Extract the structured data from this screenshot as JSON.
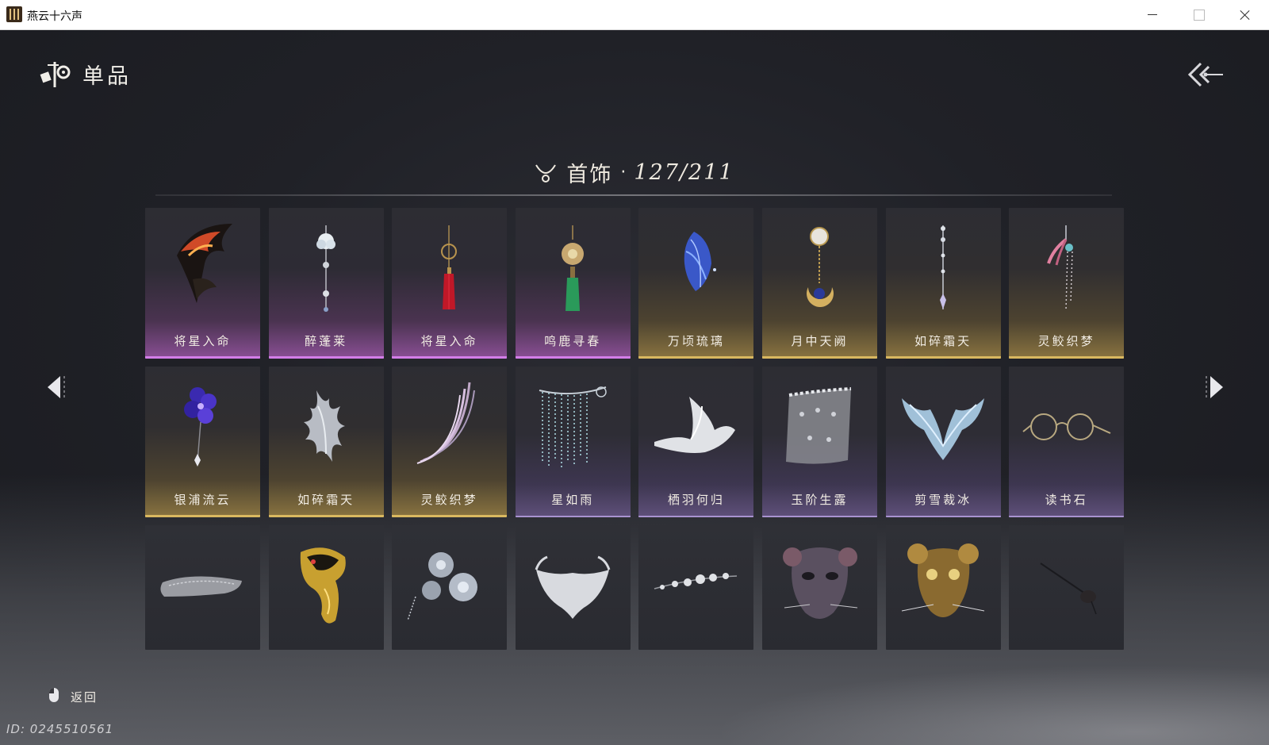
{
  "window": {
    "title": "燕云十六声"
  },
  "header": {
    "title": "单品"
  },
  "category": {
    "label": "首饰",
    "separator": "·",
    "count": "127/211"
  },
  "items": [
    {
      "name": "将星入命",
      "rarity": "purple",
      "icon": "flame-wing-ornament-icon"
    },
    {
      "name": "醉蓬莱",
      "rarity": "purple",
      "icon": "flower-pendant-icon"
    },
    {
      "name": "将星入命",
      "rarity": "purple",
      "icon": "red-tassel-pendant-icon"
    },
    {
      "name": "鸣鹿寻春",
      "rarity": "purple",
      "icon": "green-tassel-pendant-icon"
    },
    {
      "name": "万顷琉璃",
      "rarity": "gold",
      "icon": "blue-feather-ornament-icon"
    },
    {
      "name": "月中天阙",
      "rarity": "gold",
      "icon": "moon-pendant-icon"
    },
    {
      "name": "如碎霜天",
      "rarity": "gold",
      "icon": "crystal-earring-icon"
    },
    {
      "name": "灵鲛织梦",
      "rarity": "gold",
      "icon": "tassel-earring-icon"
    },
    {
      "name": "银浦流云",
      "rarity": "gold",
      "icon": "purple-flower-hairpin-icon"
    },
    {
      "name": "如碎霜天",
      "rarity": "gold",
      "icon": "silver-crest-icon"
    },
    {
      "name": "灵鲛织梦",
      "rarity": "gold",
      "icon": "feather-blade-icon"
    },
    {
      "name": "星如雨",
      "rarity": "violet",
      "icon": "beaded-veil-icon"
    },
    {
      "name": "栖羽何归",
      "rarity": "violet",
      "icon": "white-wing-icon"
    },
    {
      "name": "玉阶生露",
      "rarity": "violet",
      "icon": "lace-veil-icon"
    },
    {
      "name": "剪雪裁冰",
      "rarity": "violet",
      "icon": "ice-horns-icon"
    },
    {
      "name": "读书石",
      "rarity": "violet",
      "icon": "glasses-icon"
    },
    {
      "name": "",
      "rarity": "none",
      "icon": "silver-headband-icon"
    },
    {
      "name": "",
      "rarity": "none",
      "icon": "gold-filigree-mask-icon"
    },
    {
      "name": "",
      "rarity": "none",
      "icon": "silver-flower-hairpiece-icon"
    },
    {
      "name": "",
      "rarity": "none",
      "icon": "silver-half-mask-icon"
    },
    {
      "name": "",
      "rarity": "none",
      "icon": "flower-vine-icon"
    },
    {
      "name": "",
      "rarity": "none",
      "icon": "rat-mask-grey-icon"
    },
    {
      "name": "",
      "rarity": "none",
      "icon": "rat-mask-gold-icon"
    },
    {
      "name": "",
      "rarity": "none",
      "icon": "dark-hairpin-icon"
    }
  ],
  "footer": {
    "back_label": "返回",
    "id_text": "ID: 0245510561"
  },
  "colors": {
    "purple": "#d37ee8",
    "gold": "#d9b860",
    "violet": "#a893d0",
    "text": "#f2ede4"
  }
}
